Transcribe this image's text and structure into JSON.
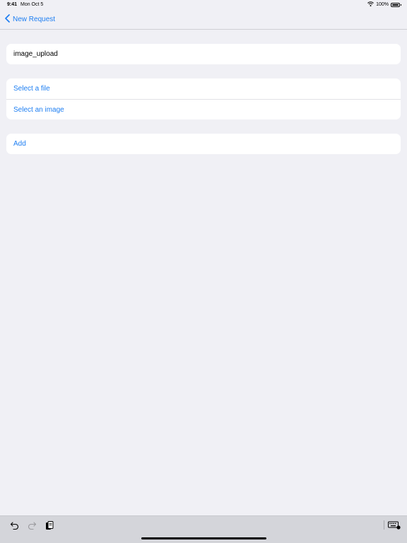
{
  "status_bar": {
    "time": "9:41",
    "date": "Mon Oct 5",
    "battery": "100%",
    "wifi_icon": "wifi-icon",
    "battery_icon": "battery-icon"
  },
  "nav": {
    "back_label": "New Request",
    "back_icon": "chevron-left-icon"
  },
  "name_field": {
    "value": "image_upload"
  },
  "attachment_options": [
    "Select a file",
    "Select an image"
  ],
  "add_label": "Add",
  "toolbar": {
    "undo_icon": "undo-icon",
    "redo_icon": "redo-icon",
    "paste_icon": "paste-icon",
    "keyboard_icon": "keyboard-icon"
  },
  "colors": {
    "accent": "#1d7ef2",
    "background": "#f0f0f5",
    "card": "#ffffff",
    "toolbar": "#d4d5da"
  }
}
